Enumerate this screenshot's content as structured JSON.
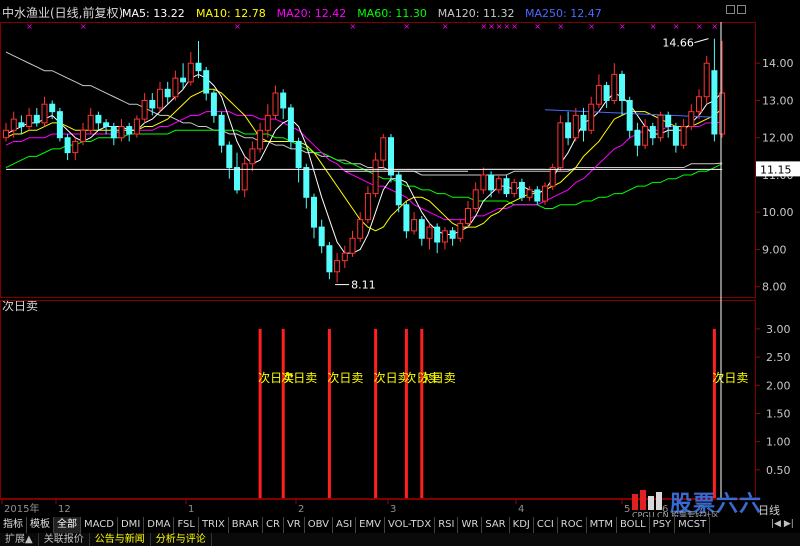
{
  "header": {
    "title": "中水渔业(日线,前复权)",
    "ma": [
      {
        "label": "MA5: 13.22",
        "color": "#ffffff"
      },
      {
        "label": "MA10: 12.78",
        "color": "#ffff00"
      },
      {
        "label": "MA20: 12.42",
        "color": "#ff00ff"
      },
      {
        "label": "MA60: 11.30",
        "color": "#00ff00"
      },
      {
        "label": "MA120: 11.32",
        "color": "#c8c8c8"
      },
      {
        "label": "MA250: 12.47",
        "color": "#4a6aff"
      }
    ]
  },
  "price_axis": {
    "ticks": [
      "14.00",
      "13.00",
      "12.00",
      "11.00",
      "10.00",
      "9.00",
      "8.00"
    ],
    "current_value": "11.15",
    "high_label": "14.66",
    "low_label": "8.11"
  },
  "indicator": {
    "title": "次日卖",
    "ticks": [
      "3.00",
      "2.50",
      "2.00",
      "1.50",
      "1.00",
      "0.50"
    ],
    "signal_label": "次日卖"
  },
  "time_axis": {
    "labels": [
      "2015年",
      "12",
      "1",
      "2",
      "3",
      "4",
      "5",
      "6",
      "7"
    ]
  },
  "tabs": {
    "left": [
      "指标",
      "模板"
    ],
    "items": [
      "全部",
      "MACD",
      "DMI",
      "DMA",
      "FSL",
      "TRIX",
      "BRAR",
      "CR",
      "VR",
      "OBV",
      "ASI",
      "EMV",
      "VOL-TDX",
      "RSI",
      "WR",
      "SAR",
      "KDJ",
      "CCI",
      "ROC",
      "MTM",
      "BOLL",
      "PSY",
      "MCST"
    ],
    "active": "全部"
  },
  "footer_tabs": [
    "扩展▲",
    "关联报价",
    "公告与新闻",
    "分析与评论"
  ],
  "period_label": "日线",
  "right_buttons": "|◀  ▶|",
  "watermark": {
    "title": "股票六六",
    "subtitle": "CPGU.CN 股票爱好社区"
  },
  "colors": {
    "up": "#ff3232",
    "down": "#54fcfc",
    "signal": "#ff2020",
    "grid": "#800000"
  },
  "chart_data": {
    "type": "candlestick",
    "series_names": [
      "MA5",
      "MA10",
      "MA20",
      "MA60",
      "MA120",
      "MA250"
    ],
    "ylim": [
      7.75,
      15.0
    ],
    "y_ticks": [
      8,
      9,
      10,
      11,
      12,
      13,
      14
    ],
    "candles": [
      {
        "o": 12.0,
        "c": 12.2,
        "h": 12.4,
        "l": 11.9
      },
      {
        "o": 12.2,
        "c": 12.5,
        "h": 12.7,
        "l": 12.0
      },
      {
        "o": 12.4,
        "c": 12.3,
        "h": 12.6,
        "l": 12.1
      },
      {
        "o": 12.3,
        "c": 12.6,
        "h": 12.8,
        "l": 12.2
      },
      {
        "o": 12.6,
        "c": 12.4,
        "h": 12.8,
        "l": 12.3
      },
      {
        "o": 12.4,
        "c": 12.9,
        "h": 13.1,
        "l": 12.3
      },
      {
        "o": 12.9,
        "c": 12.7,
        "h": 13.0,
        "l": 12.5
      },
      {
        "o": 12.7,
        "c": 12.0,
        "h": 12.8,
        "l": 11.9
      },
      {
        "o": 12.0,
        "c": 11.6,
        "h": 12.1,
        "l": 11.4
      },
      {
        "o": 11.6,
        "c": 11.9,
        "h": 12.0,
        "l": 11.4
      },
      {
        "o": 11.9,
        "c": 12.2,
        "h": 12.4,
        "l": 11.8
      },
      {
        "o": 12.2,
        "c": 12.6,
        "h": 12.8,
        "l": 12.1
      },
      {
        "o": 12.6,
        "c": 12.4,
        "h": 12.7,
        "l": 12.2
      },
      {
        "o": 12.4,
        "c": 12.3,
        "h": 12.5,
        "l": 12.1
      },
      {
        "o": 12.3,
        "c": 12.0,
        "h": 12.4,
        "l": 11.8
      },
      {
        "o": 12.0,
        "c": 12.3,
        "h": 12.5,
        "l": 11.9
      },
      {
        "o": 12.3,
        "c": 12.1,
        "h": 12.4,
        "l": 11.9
      },
      {
        "o": 12.1,
        "c": 12.5,
        "h": 12.6,
        "l": 12.0
      },
      {
        "o": 12.5,
        "c": 13.0,
        "h": 13.2,
        "l": 12.4
      },
      {
        "o": 13.0,
        "c": 12.8,
        "h": 13.2,
        "l": 12.6
      },
      {
        "o": 12.8,
        "c": 13.3,
        "h": 13.5,
        "l": 12.7
      },
      {
        "o": 13.3,
        "c": 13.1,
        "h": 13.5,
        "l": 12.9
      },
      {
        "o": 13.1,
        "c": 13.6,
        "h": 13.8,
        "l": 13.0
      },
      {
        "o": 13.6,
        "c": 13.5,
        "h": 14.0,
        "l": 13.3
      },
      {
        "o": 13.5,
        "c": 14.0,
        "h": 14.3,
        "l": 13.4
      },
      {
        "o": 14.0,
        "c": 13.8,
        "h": 14.6,
        "l": 13.6
      },
      {
        "o": 13.8,
        "c": 13.2,
        "h": 13.9,
        "l": 13.0
      },
      {
        "o": 13.2,
        "c": 12.6,
        "h": 13.3,
        "l": 12.4
      },
      {
        "o": 12.6,
        "c": 11.8,
        "h": 12.7,
        "l": 11.6
      },
      {
        "o": 11.8,
        "c": 11.2,
        "h": 11.9,
        "l": 10.9
      },
      {
        "o": 11.2,
        "c": 10.6,
        "h": 11.6,
        "l": 10.5
      },
      {
        "o": 10.6,
        "c": 11.3,
        "h": 11.5,
        "l": 10.4
      },
      {
        "o": 11.3,
        "c": 11.7,
        "h": 11.9,
        "l": 11.1
      },
      {
        "o": 11.7,
        "c": 12.2,
        "h": 12.4,
        "l": 11.6
      },
      {
        "o": 12.2,
        "c": 12.6,
        "h": 12.9,
        "l": 12.0
      },
      {
        "o": 12.6,
        "c": 13.2,
        "h": 13.4,
        "l": 12.5
      },
      {
        "o": 13.2,
        "c": 12.8,
        "h": 13.3,
        "l": 12.5
      },
      {
        "o": 12.8,
        "c": 11.9,
        "h": 12.9,
        "l": 11.7
      },
      {
        "o": 11.9,
        "c": 11.2,
        "h": 12.0,
        "l": 10.8
      },
      {
        "o": 11.2,
        "c": 10.4,
        "h": 11.3,
        "l": 10.1
      },
      {
        "o": 10.4,
        "c": 9.6,
        "h": 10.5,
        "l": 9.3
      },
      {
        "o": 9.6,
        "c": 9.1,
        "h": 9.8,
        "l": 8.9
      },
      {
        "o": 9.1,
        "c": 8.4,
        "h": 9.2,
        "l": 8.2
      },
      {
        "o": 8.4,
        "c": 8.7,
        "h": 8.9,
        "l": 8.11
      },
      {
        "o": 8.7,
        "c": 8.9,
        "h": 9.1,
        "l": 8.5
      },
      {
        "o": 8.9,
        "c": 9.3,
        "h": 9.5,
        "l": 8.8
      },
      {
        "o": 9.3,
        "c": 9.8,
        "h": 10.0,
        "l": 9.2
      },
      {
        "o": 9.8,
        "c": 10.5,
        "h": 10.7,
        "l": 9.7
      },
      {
        "o": 10.5,
        "c": 11.4,
        "h": 11.6,
        "l": 10.4
      },
      {
        "o": 11.4,
        "c": 12.0,
        "h": 12.1,
        "l": 11.2
      },
      {
        "o": 12.0,
        "c": 11.0,
        "h": 12.1,
        "l": 10.8
      },
      {
        "o": 11.0,
        "c": 10.2,
        "h": 11.1,
        "l": 10.0
      },
      {
        "o": 10.2,
        "c": 9.5,
        "h": 10.3,
        "l": 9.3
      },
      {
        "o": 9.5,
        "c": 9.8,
        "h": 10.0,
        "l": 9.4
      },
      {
        "o": 9.8,
        "c": 9.3,
        "h": 9.9,
        "l": 9.1
      },
      {
        "o": 9.3,
        "c": 9.6,
        "h": 9.7,
        "l": 9.0
      },
      {
        "o": 9.6,
        "c": 9.2,
        "h": 9.7,
        "l": 8.9
      },
      {
        "o": 9.2,
        "c": 9.5,
        "h": 9.6,
        "l": 9.0
      },
      {
        "o": 9.5,
        "c": 9.3,
        "h": 9.6,
        "l": 9.1
      },
      {
        "o": 9.3,
        "c": 9.7,
        "h": 9.8,
        "l": 9.2
      },
      {
        "o": 9.7,
        "c": 10.1,
        "h": 10.3,
        "l": 9.6
      },
      {
        "o": 10.1,
        "c": 10.6,
        "h": 10.8,
        "l": 10.0
      },
      {
        "o": 10.6,
        "c": 11.0,
        "h": 11.2,
        "l": 10.5
      },
      {
        "o": 11.0,
        "c": 10.6,
        "h": 11.1,
        "l": 10.4
      },
      {
        "o": 10.6,
        "c": 10.9,
        "h": 11.0,
        "l": 10.5
      },
      {
        "o": 10.9,
        "c": 10.5,
        "h": 11.0,
        "l": 10.4
      },
      {
        "o": 10.5,
        "c": 10.8,
        "h": 10.9,
        "l": 10.4
      },
      {
        "o": 10.8,
        "c": 10.4,
        "h": 10.9,
        "l": 10.3
      },
      {
        "o": 10.4,
        "c": 10.6,
        "h": 10.7,
        "l": 10.3
      },
      {
        "o": 10.6,
        "c": 10.3,
        "h": 10.7,
        "l": 10.2
      },
      {
        "o": 10.3,
        "c": 10.7,
        "h": 10.8,
        "l": 10.2
      },
      {
        "o": 10.7,
        "c": 11.2,
        "h": 11.3,
        "l": 10.6
      },
      {
        "o": 11.2,
        "c": 12.4,
        "h": 12.6,
        "l": 11.1
      },
      {
        "o": 12.4,
        "c": 12.0,
        "h": 12.7,
        "l": 11.8
      },
      {
        "o": 12.0,
        "c": 12.6,
        "h": 12.8,
        "l": 11.9
      },
      {
        "o": 12.6,
        "c": 12.2,
        "h": 12.8,
        "l": 11.9
      },
      {
        "o": 12.2,
        "c": 12.9,
        "h": 13.1,
        "l": 12.1
      },
      {
        "o": 12.9,
        "c": 13.4,
        "h": 13.7,
        "l": 12.8
      },
      {
        "o": 13.4,
        "c": 13.0,
        "h": 13.5,
        "l": 12.8
      },
      {
        "o": 13.0,
        "c": 13.7,
        "h": 14.0,
        "l": 12.9
      },
      {
        "o": 13.7,
        "c": 13.0,
        "h": 13.8,
        "l": 12.6
      },
      {
        "o": 13.0,
        "c": 12.2,
        "h": 13.1,
        "l": 12.0
      },
      {
        "o": 12.2,
        "c": 11.8,
        "h": 12.4,
        "l": 11.5
      },
      {
        "o": 11.8,
        "c": 12.3,
        "h": 12.5,
        "l": 11.7
      },
      {
        "o": 12.3,
        "c": 12.0,
        "h": 12.4,
        "l": 11.8
      },
      {
        "o": 12.0,
        "c": 12.6,
        "h": 12.7,
        "l": 11.9
      },
      {
        "o": 12.6,
        "c": 12.3,
        "h": 12.7,
        "l": 12.0
      },
      {
        "o": 12.3,
        "c": 11.8,
        "h": 12.4,
        "l": 11.6
      },
      {
        "o": 11.8,
        "c": 12.3,
        "h": 12.5,
        "l": 11.7
      },
      {
        "o": 12.3,
        "c": 12.7,
        "h": 12.9,
        "l": 12.2
      },
      {
        "o": 12.7,
        "c": 13.1,
        "h": 13.3,
        "l": 12.5
      },
      {
        "o": 13.1,
        "c": 14.0,
        "h": 14.2,
        "l": 12.9
      },
      {
        "o": 13.8,
        "c": 12.1,
        "h": 14.66,
        "l": 11.9
      },
      {
        "o": 12.1,
        "c": 13.2,
        "h": 14.6,
        "l": 12.0
      }
    ],
    "ma5": [
      12.1,
      12.2,
      12.3,
      12.4,
      12.4,
      12.5,
      12.6,
      12.4,
      12.2,
      12.0,
      11.9,
      12.0,
      12.2,
      12.3,
      12.3,
      12.3,
      12.2,
      12.2,
      12.4,
      12.5,
      12.7,
      12.9,
      13.1,
      13.3,
      13.6,
      13.7,
      13.6,
      13.4,
      13.1,
      12.5,
      11.9,
      11.5,
      11.3,
      11.4,
      11.8,
      12.2,
      12.4,
      12.5,
      12.3,
      11.8,
      11.1,
      10.4,
      9.8,
      9.2,
      8.9,
      8.9,
      9.0,
      9.4,
      10.0,
      10.6,
      10.9,
      10.9,
      10.8,
      10.4,
      10.0,
      9.7,
      9.5,
      9.4,
      9.4,
      9.5,
      9.6,
      9.9,
      10.3,
      10.5,
      10.7,
      10.7,
      10.6,
      10.7,
      10.6,
      10.5,
      10.6,
      10.9,
      11.3,
      11.6,
      12.0,
      12.4,
      12.5,
      12.7,
      13.0,
      13.2,
      13.1,
      12.9,
      12.6,
      12.3,
      12.1,
      12.1,
      12.2,
      12.2,
      12.2,
      12.4,
      12.6,
      12.9,
      13.0,
      13.22
    ],
    "ma10": [
      12.0,
      12.1,
      12.1,
      12.2,
      12.2,
      12.3,
      12.4,
      12.4,
      12.3,
      12.2,
      12.2,
      12.2,
      12.2,
      12.2,
      12.2,
      12.2,
      12.2,
      12.2,
      12.3,
      12.3,
      12.4,
      12.5,
      12.7,
      12.9,
      13.1,
      13.2,
      13.3,
      13.3,
      13.2,
      13.0,
      12.8,
      12.6,
      12.3,
      12.0,
      11.9,
      11.9,
      11.9,
      11.9,
      11.9,
      11.8,
      11.6,
      11.3,
      11.0,
      10.7,
      10.4,
      10.1,
      9.8,
      9.6,
      9.5,
      9.6,
      9.9,
      10.1,
      10.3,
      10.4,
      10.4,
      10.3,
      10.1,
      9.9,
      9.7,
      9.6,
      9.6,
      9.6,
      9.7,
      9.9,
      10.0,
      10.2,
      10.3,
      10.4,
      10.5,
      10.5,
      10.6,
      10.7,
      10.8,
      11.0,
      11.2,
      11.5,
      11.7,
      11.9,
      12.2,
      12.5,
      12.6,
      12.7,
      12.7,
      12.7,
      12.6,
      12.5,
      12.4,
      12.3,
      12.3,
      12.3,
      12.4,
      12.5,
      12.6,
      12.78
    ],
    "ma20": [
      11.8,
      11.9,
      11.9,
      12.0,
      12.0,
      12.0,
      12.1,
      12.1,
      12.1,
      12.1,
      12.1,
      12.1,
      12.1,
      12.1,
      12.1,
      12.2,
      12.2,
      12.2,
      12.2,
      12.2,
      12.3,
      12.3,
      12.4,
      12.5,
      12.6,
      12.6,
      12.7,
      12.7,
      12.7,
      12.7,
      12.6,
      12.6,
      12.6,
      12.5,
      12.5,
      12.5,
      12.4,
      12.3,
      12.2,
      12.0,
      11.8,
      11.6,
      11.4,
      11.3,
      11.1,
      11.0,
      10.9,
      10.8,
      10.7,
      10.7,
      10.6,
      10.5,
      10.4,
      10.2,
      10.1,
      10.0,
      9.9,
      9.8,
      9.8,
      9.8,
      9.8,
      9.9,
      9.9,
      10.0,
      10.1,
      10.1,
      10.2,
      10.2,
      10.2,
      10.2,
      10.3,
      10.4,
      10.5,
      10.6,
      10.8,
      10.9,
      11.1,
      11.3,
      11.5,
      11.7,
      11.8,
      12.0,
      12.1,
      12.2,
      12.2,
      12.2,
      12.3,
      12.3,
      12.3,
      12.3,
      12.3,
      12.4,
      12.4,
      12.42
    ],
    "ma60": [
      11.2,
      11.3,
      11.4,
      11.5,
      11.5,
      11.6,
      11.7,
      11.7,
      11.8,
      11.8,
      11.9,
      11.9,
      12.0,
      12.0,
      12.0,
      12.0,
      12.1,
      12.1,
      12.1,
      12.1,
      12.1,
      12.1,
      12.2,
      12.2,
      12.2,
      12.2,
      12.2,
      12.2,
      12.2,
      12.2,
      12.2,
      12.1,
      12.1,
      12.1,
      12.1,
      12.0,
      12.0,
      11.9,
      11.8,
      11.7,
      11.6,
      11.6,
      11.5,
      11.4,
      11.3,
      11.3,
      11.2,
      11.1,
      11.0,
      10.9,
      10.9,
      10.8,
      10.7,
      10.7,
      10.6,
      10.6,
      10.5,
      10.5,
      10.4,
      10.4,
      10.4,
      10.3,
      10.3,
      10.3,
      10.3,
      10.3,
      10.2,
      10.2,
      10.2,
      10.2,
      10.1,
      10.1,
      10.2,
      10.2,
      10.2,
      10.3,
      10.3,
      10.4,
      10.4,
      10.5,
      10.5,
      10.6,
      10.7,
      10.7,
      10.8,
      10.8,
      10.9,
      10.9,
      11.0,
      11.0,
      11.1,
      11.1,
      11.2,
      11.3
    ],
    "ma120": [
      14.3,
      14.2,
      14.1,
      14.0,
      13.9,
      13.8,
      13.8,
      13.7,
      13.6,
      13.5,
      13.4,
      13.4,
      13.3,
      13.2,
      13.1,
      13.0,
      12.9,
      12.9,
      12.8,
      12.7,
      12.6,
      12.6,
      12.5,
      12.4,
      12.4,
      12.3,
      12.3,
      12.2,
      12.2,
      12.1,
      12.1,
      12.0,
      12.0,
      11.9,
      11.9,
      11.8,
      11.8,
      11.7,
      11.7,
      11.6,
      11.6,
      11.5,
      11.5,
      11.4,
      11.4,
      11.3,
      11.3,
      11.2,
      11.2,
      11.2,
      11.1,
      11.1,
      11.1,
      11.1,
      11.0,
      11.0,
      11.0,
      11.0,
      11.0,
      11.0,
      11.0,
      11.0,
      11.0,
      11.0,
      11.0,
      11.0,
      11.1,
      11.1,
      11.1,
      11.1,
      11.1,
      11.1,
      11.1,
      11.1,
      11.2,
      11.2,
      11.2,
      11.2,
      11.2,
      11.2,
      11.2,
      11.2,
      11.2,
      11.2,
      11.2,
      11.2,
      11.2,
      11.2,
      11.2,
      11.3,
      11.3,
      11.3,
      11.3,
      11.32
    ],
    "ma250_x_range": [
      70,
      92
    ],
    "ma250_value": 12.6,
    "ref_lines": [
      {
        "y": 11.15,
        "x0": 0,
        "x1": 93,
        "color": "#ffffff"
      },
      {
        "y": 11.1,
        "x0": 44,
        "x1": 60,
        "color": "#e0e0e0"
      },
      {
        "y": 11.15,
        "x0": 62,
        "x1": 70,
        "color": "#e0e0e0"
      }
    ],
    "top_marks_idx": [
      3,
      10,
      30,
      45,
      52,
      57,
      62,
      63,
      64,
      65,
      66,
      69,
      72,
      76,
      80,
      84,
      87,
      90,
      92
    ],
    "signal_idx": [
      33,
      36,
      42,
      48,
      52,
      54,
      92
    ],
    "signal_value": 3.0,
    "indicator_ylim": [
      0,
      3.3
    ]
  }
}
